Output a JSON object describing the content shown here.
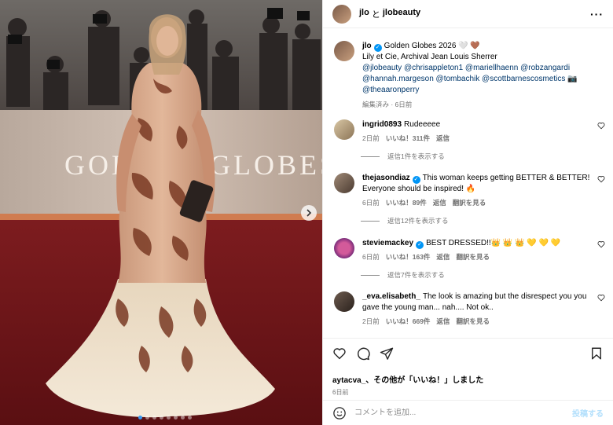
{
  "media": {
    "backdrop_text": "GOLDEN GLOBES",
    "dots_total": 8,
    "active_dot": 0
  },
  "header": {
    "user1": "jlo",
    "connector": "と",
    "user2": "jlobeauty",
    "more_icon": "more-horizontal-icon"
  },
  "caption": {
    "username": "jlo",
    "line1": "Golden Globes 2026 🤍 🤎",
    "line2": "Lily et Cie, Archival Jean Louis Sherrer",
    "mentions_line1": "@jlobeauty @chrisappleton1 @mariellhaenn @robzangardi",
    "mentions_line2": "@hannah.margeson @tombachik @scottbarnescosmetics 📷",
    "mentions_line3": "@theaaronperry",
    "edited": "編集済み · 6日前"
  },
  "comments": [
    {
      "username": "ingrid0893",
      "verified": false,
      "text": "Rudeeeee",
      "time": "2日前",
      "likes": "いいね！311件",
      "reply": "返信",
      "translate": "",
      "view_replies": "返信1件を表示する"
    },
    {
      "username": "thejasondiaz",
      "verified": true,
      "text": "This woman keeps getting BETTER & BETTER! Everyone should be inspired! 🔥",
      "time": "6日前",
      "likes": "いいね！89件",
      "reply": "返信",
      "translate": "翻訳を見る",
      "view_replies": "返信12件を表示する"
    },
    {
      "username": "steviemackey",
      "verified": true,
      "text": "BEST DRESSED!!👑 👑 👑 💛 💛 💛",
      "time": "6日前",
      "likes": "いいね！163件",
      "reply": "返信",
      "translate": "翻訳を見る",
      "view_replies": "返信7件を表示する"
    },
    {
      "username": "_eva.elisabeth_",
      "verified": false,
      "text": "The look is amazing but the disrespect you you gave the young man... nah.... Not ok..",
      "time": "2日前",
      "likes": "いいね！669件",
      "reply": "返信",
      "translate": "翻訳を見る",
      "view_replies": ""
    }
  ],
  "actions": {
    "liked_by_user": "aytacva_",
    "liked_by_rest": "、その他が「いいね！」しました",
    "ago": "6日前"
  },
  "composer": {
    "placeholder": "コメントを追加...",
    "post_label": "投稿する"
  },
  "colors": {
    "link": "#00376b",
    "verified": "#0095f6",
    "muted": "#737373"
  }
}
